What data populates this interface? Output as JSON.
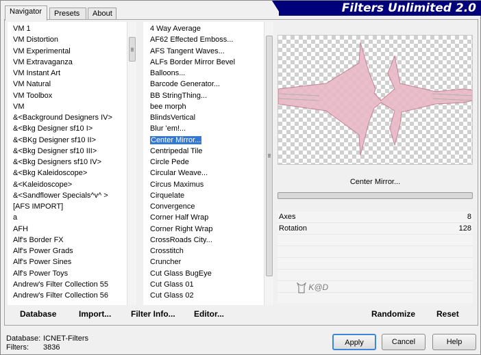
{
  "tabs": [
    "Navigator",
    "Presets",
    "About"
  ],
  "logo": "Filters Unlimited 2.0",
  "categories": [
    "VM 1",
    "VM Distortion",
    "VM Experimental",
    "VM Extravaganza",
    "VM Instant Art",
    "VM Natural",
    "VM Toolbox",
    "VM",
    "&<Background Designers IV>",
    "&<Bkg Designer sf10 I>",
    "&<BKg Designer sf10 II>",
    "&<Bkg Designer sf10 III>",
    "&<Bkg Designers sf10 IV>",
    "&<Bkg Kaleidoscope>",
    "&<Kaleidoscope>",
    "&<Sandflower Specials^v^ >",
    "[AFS IMPORT]",
    "a",
    "AFH",
    "Alf's Border FX",
    "Alf's Power Grads",
    "Alf's Power Sines",
    "Alf's Power Toys",
    "Andrew's Filter Collection 55",
    "Andrew's Filter Collection 56"
  ],
  "filters": [
    "4 Way Average",
    "AF62 Effected Emboss...",
    "AFS Tangent Waves...",
    "ALFs Border Mirror Bevel",
    "Balloons...",
    "Barcode Generator...",
    "BB StringThing...",
    "bee morph",
    "BlindsVertical",
    "Blur 'em!...",
    "Center Mirror...",
    "Centripedal Tile",
    "Circle Pede",
    "Circular Weave...",
    "Circus Maximus",
    "Cirquelate",
    "Convergence",
    "Corner Half Wrap",
    "Corner Right Wrap",
    "CrossRoads City...",
    "Crosstitch",
    "Cruncher",
    "Cut Glass  BugEye",
    "Cut Glass 01",
    "Cut Glass 02"
  ],
  "selected_filter": "Center Mirror...",
  "filter_title": "Center Mirror...",
  "params": [
    {
      "label": "Axes",
      "value": "8"
    },
    {
      "label": "Rotation",
      "value": "128"
    }
  ],
  "watermark": "K@D",
  "toolbar": {
    "database": "Database",
    "import": "Import...",
    "filter_info": "Filter Info...",
    "editor": "Editor...",
    "randomize": "Randomize",
    "reset": "Reset"
  },
  "status": {
    "db_label": "Database:",
    "db_value": "ICNET-Filters",
    "filters_label": "Filters:",
    "filters_value": "3836"
  },
  "buttons": {
    "apply": "Apply",
    "cancel": "Cancel",
    "help": "Help"
  },
  "colors": {
    "selection": "#3478d6",
    "logo_bg": "#00007a",
    "preview_pink": "#e8b4c4"
  }
}
